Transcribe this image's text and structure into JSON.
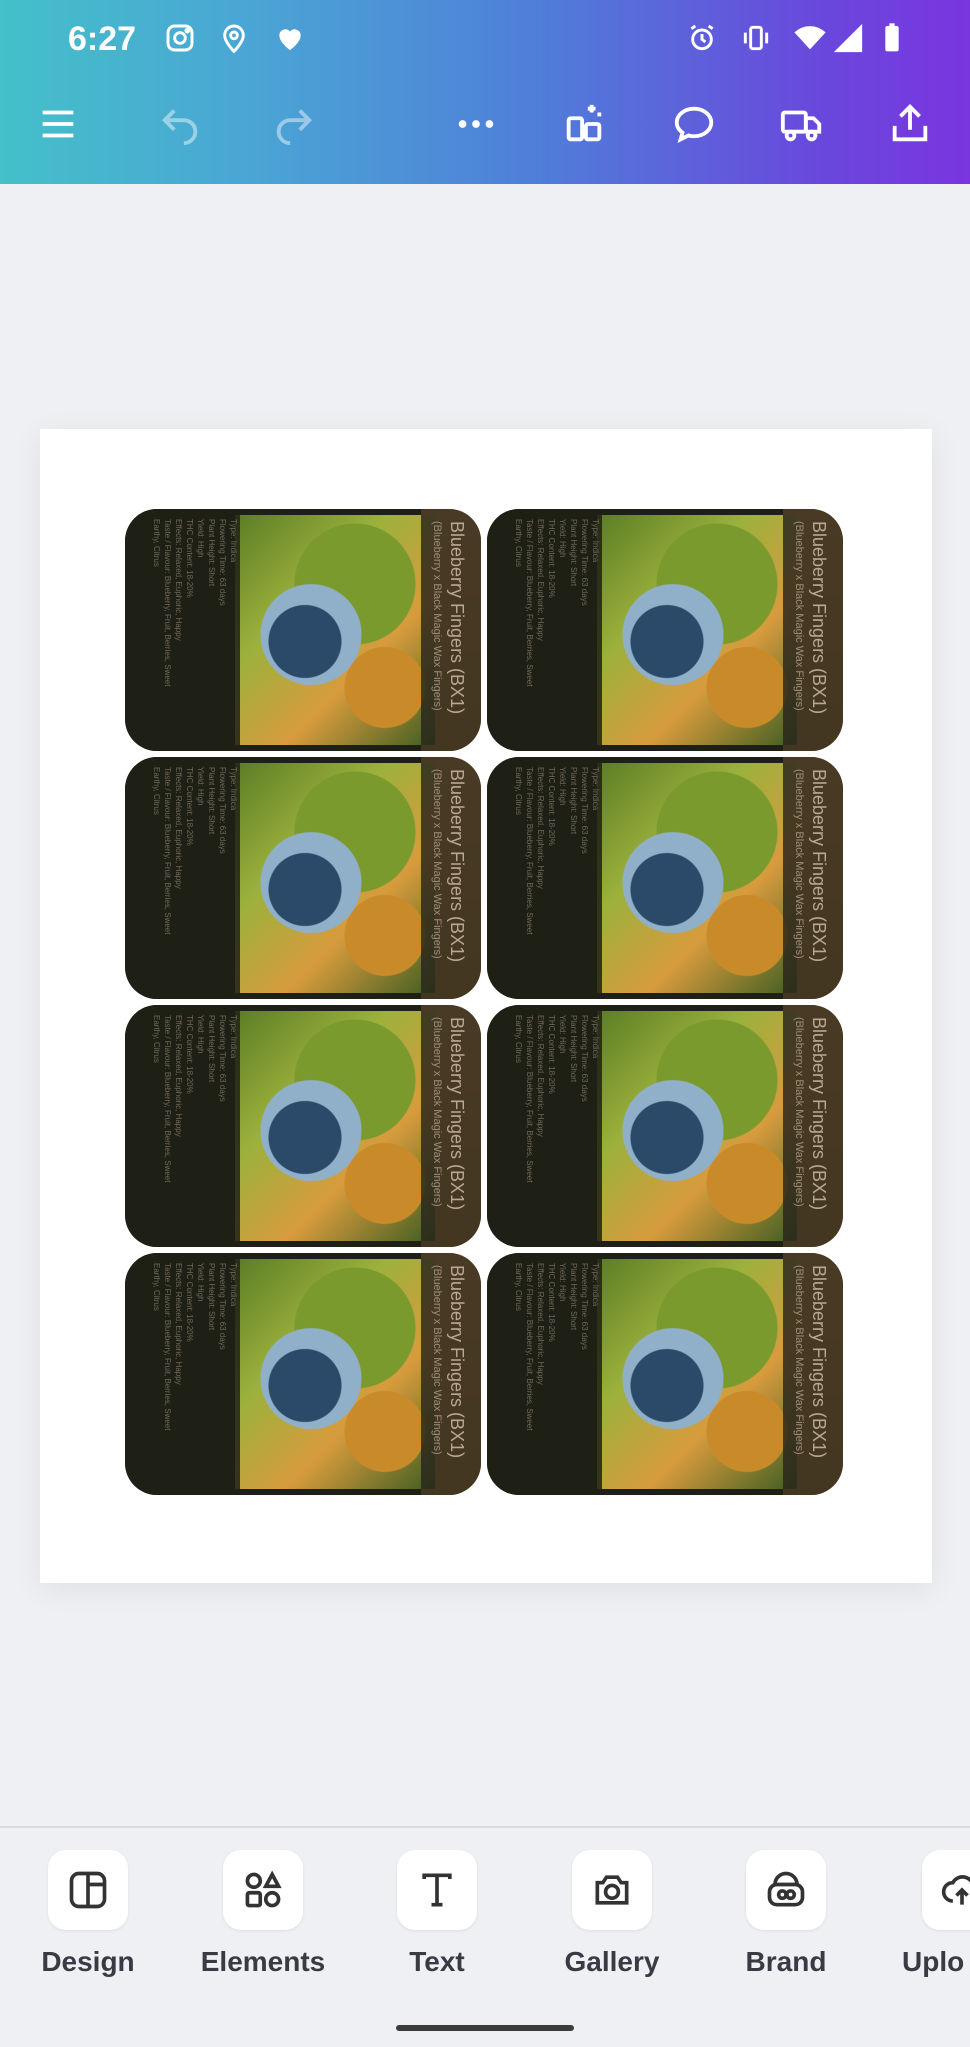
{
  "status_bar": {
    "time": "6:27"
  },
  "toolbar": {
    "menu_icon": "hamburger-icon",
    "undo_icon": "undo-icon",
    "redo_icon": "redo-icon",
    "more_icon": "more-horizontal-icon",
    "magic_icon": "magic-switch-icon",
    "comment_icon": "comment-icon",
    "delivery_icon": "truck-icon",
    "share_icon": "share-icon"
  },
  "canvas": {
    "card_title": "Blueberry Fingers (BX1)",
    "card_subtitle": "(Blueberry x Black Magic Wax Fingers)",
    "card_details": "Type: Indica\nFlowering Time: 63 days\nPlant Height: Short\nYield: High\nTHC Content: 18-20%\nEffects: Relaxed, Euphoric, Happy\nTaste / Flavour: Blueberry, Fruit, Berries, Sweet\nEarthy, Citrus",
    "card_count": 8
  },
  "bottom_nav": {
    "items": [
      {
        "label": "Design",
        "icon": "design-layout-icon"
      },
      {
        "label": "Elements",
        "icon": "elements-shapes-icon"
      },
      {
        "label": "Text",
        "icon": "text-icon"
      },
      {
        "label": "Gallery",
        "icon": "camera-icon"
      },
      {
        "label": "Brand",
        "icon": "brand-kit-icon"
      },
      {
        "label": "Uplo",
        "icon": "upload-cloud-icon"
      }
    ]
  },
  "colors": {
    "gradient_start": "#44c0c9",
    "gradient_end": "#7a35df",
    "canvas_bg": "#eff0f4",
    "page_bg": "#ffffff"
  }
}
